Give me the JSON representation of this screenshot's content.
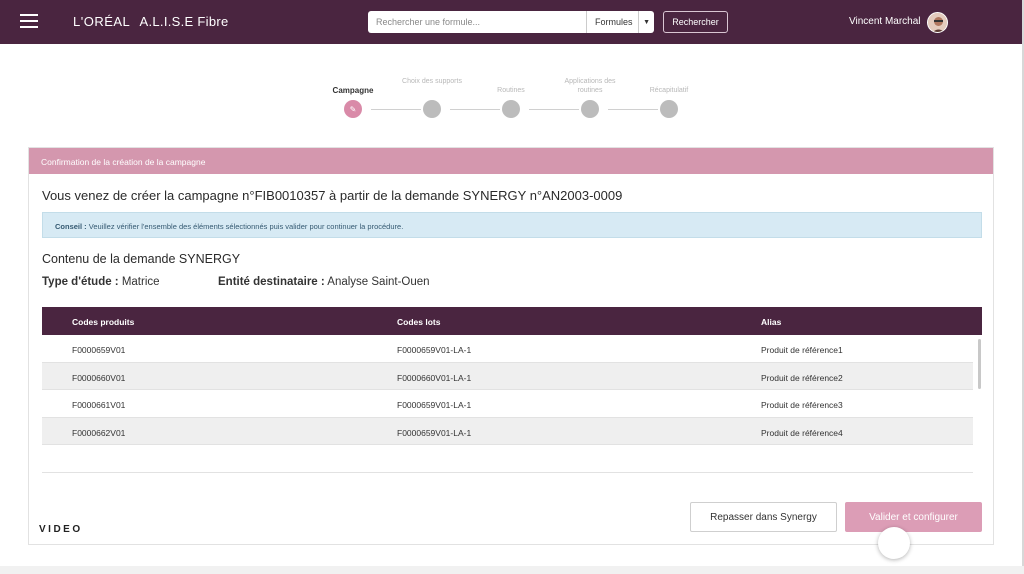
{
  "header": {
    "brand_logo": "L'ORÉAL",
    "brand_app": "A.L.I.S.E Fibre",
    "search_placeholder": "Rechercher une formule...",
    "filter_value": "Formules",
    "search_button": "Rechercher",
    "user_name": "Vincent Marchal"
  },
  "stepper": {
    "steps": [
      {
        "label": "Campagne",
        "active": true
      },
      {
        "label": "Choix des supports",
        "active": false
      },
      {
        "label": "Routines",
        "active": false
      },
      {
        "label": "Applications des routines",
        "active": false
      },
      {
        "label": "Récapitulatif",
        "active": false
      }
    ]
  },
  "card": {
    "header": "Confirmation de la création de la campagne",
    "title": "Vous venez de créer la campagne n°FIB0010357 à partir de la demande SYNERGY n°AN2003-0009",
    "tip_label": "Conseil :",
    "tip_text": " Veuillez vérifier l'ensemble des éléments sélectionnés puis valider pour continuer la procédure.",
    "section_title": "Contenu de la demande SYNERGY",
    "study_type_label": "Type d'étude :",
    "study_type_value": " Matrice",
    "entity_label": "Entité destinataire :",
    "entity_value": " Analyse Saint-Ouen"
  },
  "table": {
    "columns": [
      "Codes produits",
      "Codes lots",
      "Alias"
    ],
    "rows": [
      [
        "F0000659V01",
        "F0000659V01-LA-1",
        "Produit de référence1"
      ],
      [
        "F0000660V01",
        "F0000660V01-LA-1",
        "Produit de référence2"
      ],
      [
        "F0000661V01",
        "F0000659V01-LA-1",
        "Produit de référence3"
      ],
      [
        "F0000662V01",
        "F0000659V01-LA-1",
        "Produit de référence4"
      ]
    ]
  },
  "actions": {
    "secondary": "Repasser dans Synergy",
    "primary": "Valider et configurer"
  },
  "video_label": "VIDEO",
  "colors": {
    "topbar": "#4a2540",
    "accent_pink": "#d497ae",
    "primary_button": "#dc9db6",
    "tip_background": "#d7eaf4"
  },
  "icons": {
    "menu": "hamburger-icon",
    "dropdown": "caret-down-icon",
    "step_edit": "pencil-icon",
    "avatar": "user-avatar"
  }
}
